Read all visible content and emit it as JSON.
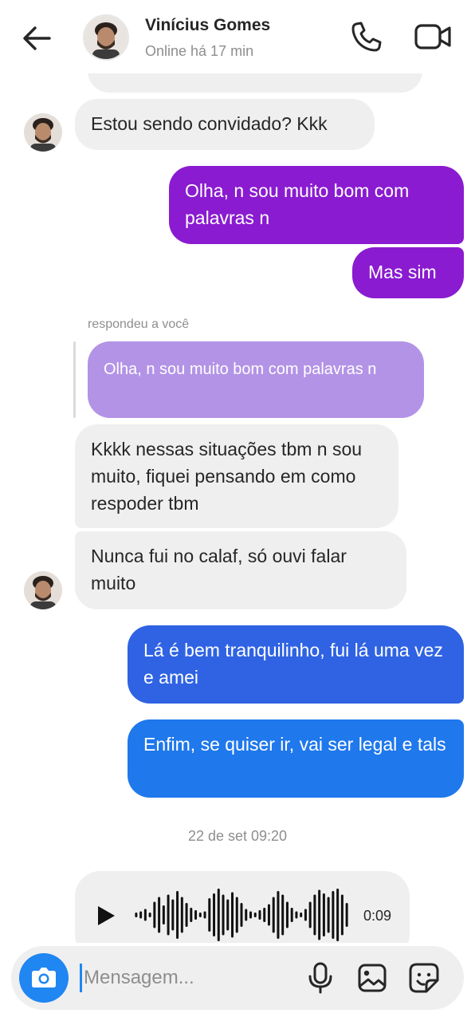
{
  "header": {
    "name": "Vinícius Gomes",
    "status": "Online há 17 min"
  },
  "messages": {
    "m1": "Estou sendo convidado? Kkk",
    "m2": "Olha, n sou muito bom com palavras n",
    "m3": "Mas sim",
    "reply_caption": "respondeu a você",
    "reply_quote": "Olha, n sou muito bom com palavras n",
    "m4": "Kkkk nessas situações tbm n sou muito, fiquei pensando em como respoder tbm",
    "m5": "Nunca fui no calaf, só ouvi falar muito",
    "m6": "Lá é bem tranquilinho, fui lá uma vez e amei",
    "m7": "Enfim, se quiser ir, vai ser legal e tals"
  },
  "timestamp": "22 de set 09:20",
  "voice_message": {
    "duration": "0:09"
  },
  "composer": {
    "placeholder": "Mensagem..."
  },
  "icons": {
    "back": "arrow-left-icon",
    "call": "phone-icon",
    "video": "video-camera-icon",
    "play": "play-icon",
    "camera": "camera-icon",
    "mic": "microphone-icon",
    "gallery": "image-icon",
    "sticker": "sticker-icon"
  },
  "colors": {
    "outgoing_purple": "#8a1bd0",
    "outgoing_blue": "#2f63e3",
    "outgoing_blue_light": "#1f78ec",
    "incoming": "#efefef",
    "reply_quote": "#b393e6",
    "accent": "#1f86f2"
  }
}
